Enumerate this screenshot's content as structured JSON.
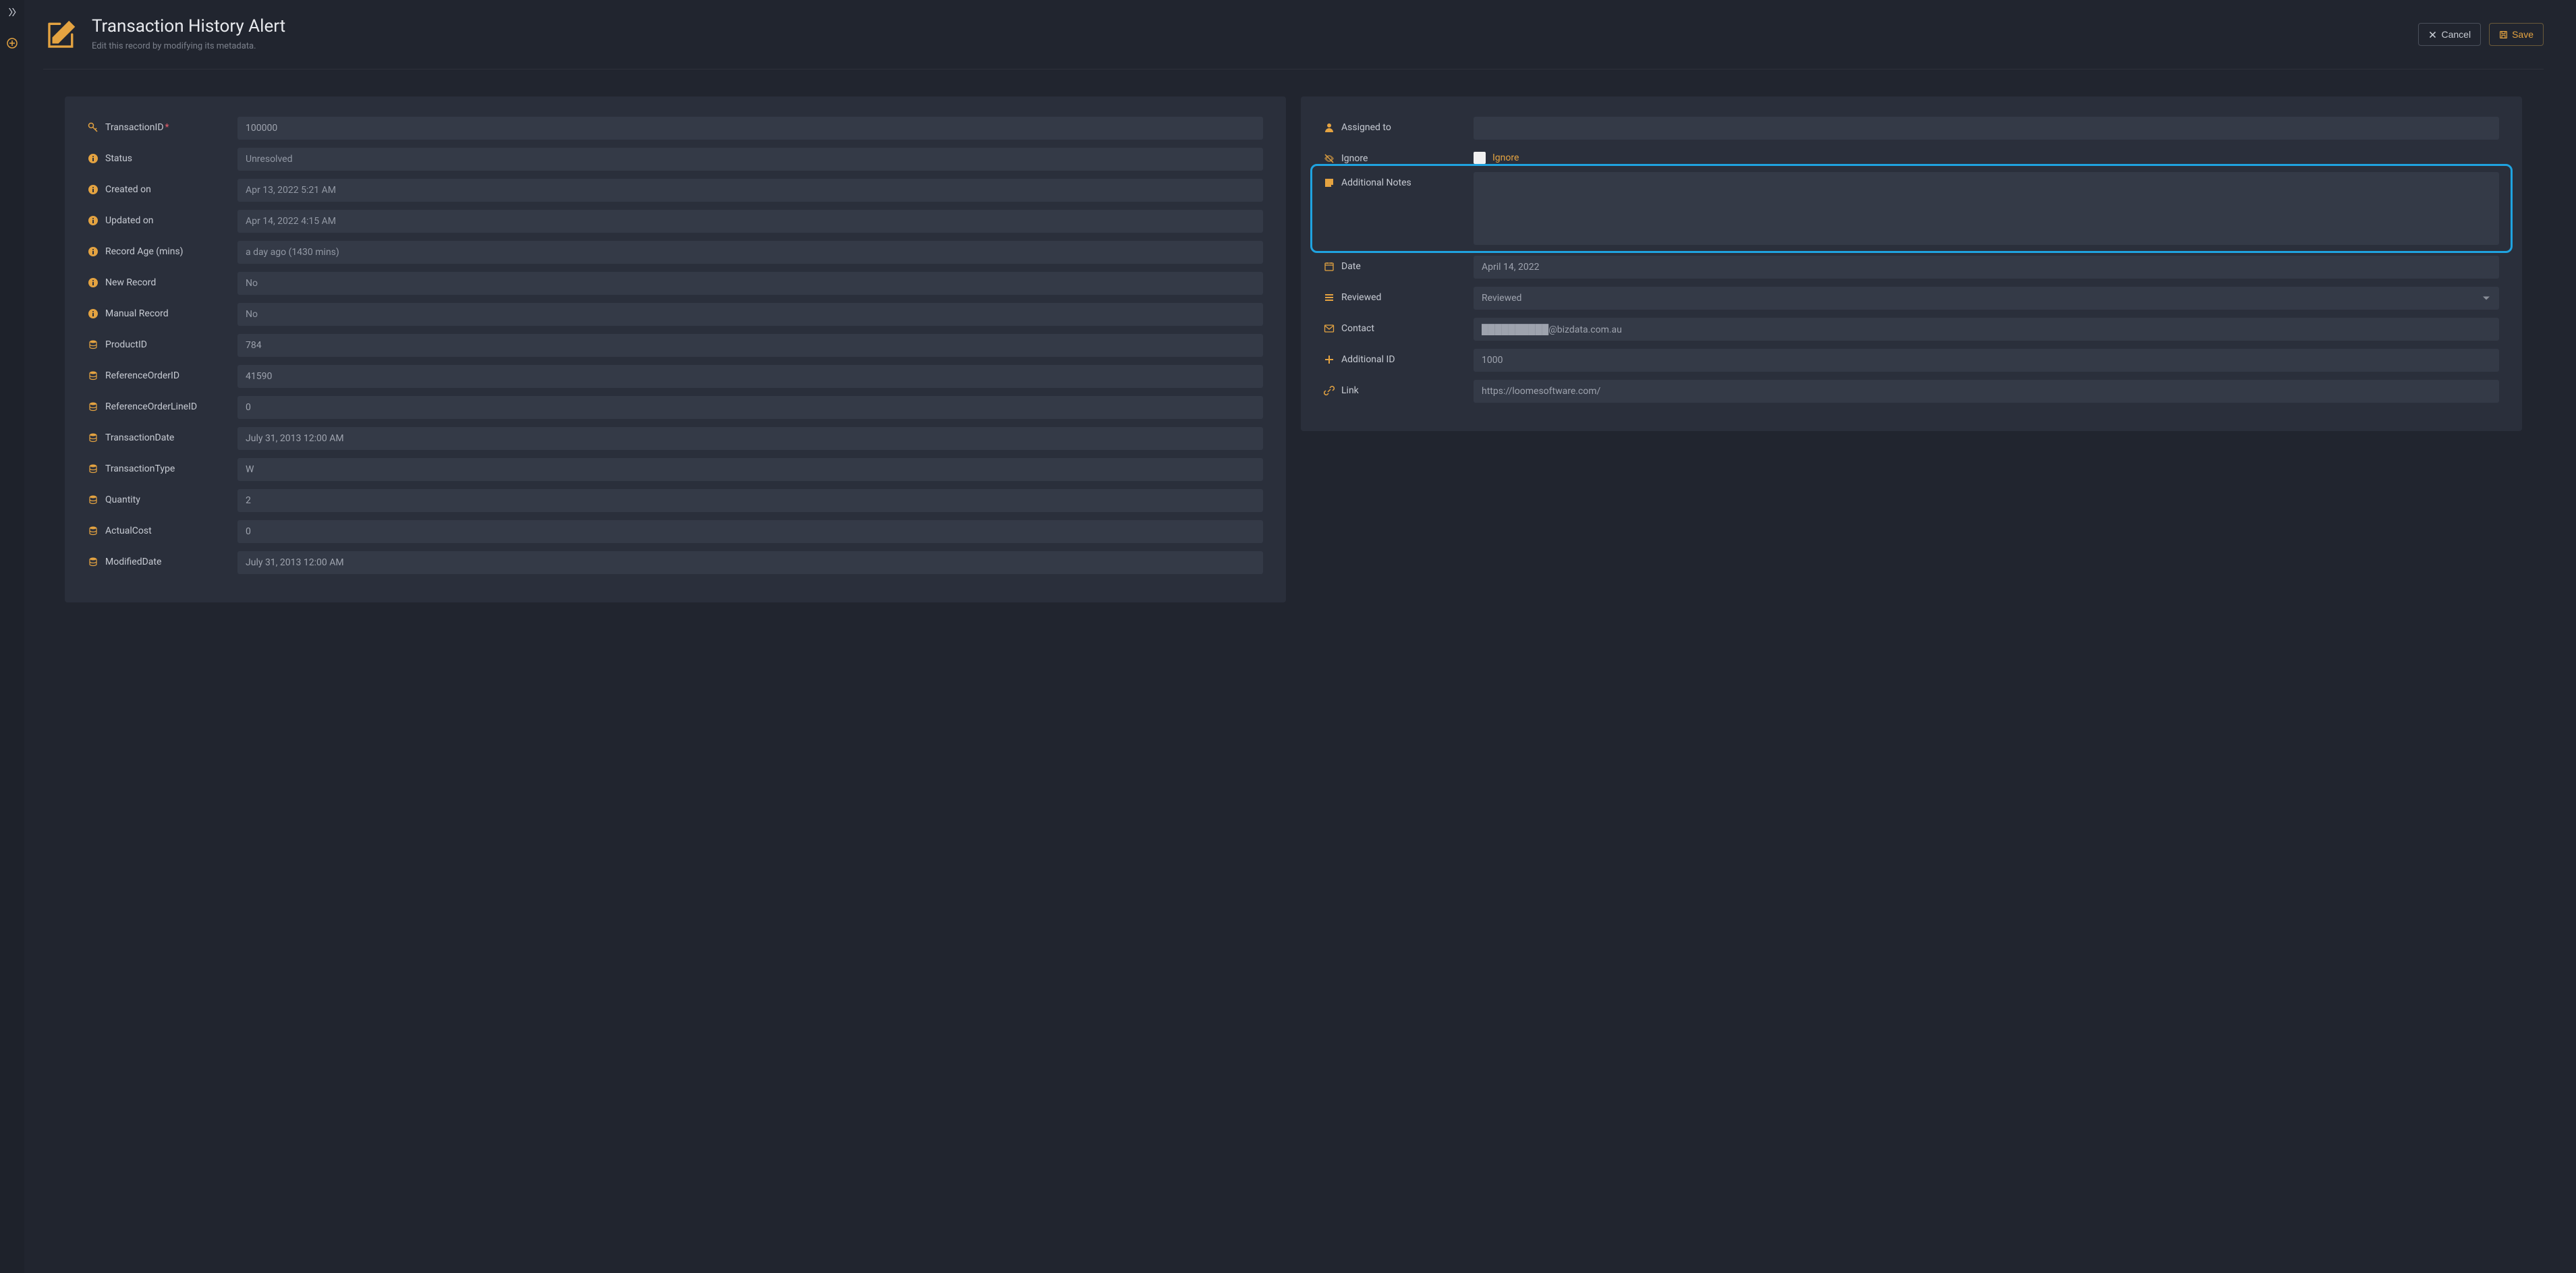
{
  "header": {
    "title": "Transaction History Alert",
    "subtitle": "Edit this record by modifying its metadata.",
    "cancel": "Cancel",
    "save": "Save"
  },
  "left": {
    "transactionId": {
      "label": "TransactionID",
      "value": "100000"
    },
    "status": {
      "label": "Status",
      "value": "Unresolved"
    },
    "createdOn": {
      "label": "Created on",
      "value": "Apr 13, 2022 5:21 AM"
    },
    "updatedOn": {
      "label": "Updated on",
      "value": "Apr 14, 2022 4:15 AM"
    },
    "recordAge": {
      "label": "Record Age (mins)",
      "value": "a day ago (1430 mins)"
    },
    "newRecord": {
      "label": "New Record",
      "value": "No"
    },
    "manualRecord": {
      "label": "Manual Record",
      "value": "No"
    },
    "productId": {
      "label": "ProductID",
      "value": "784"
    },
    "refOrderId": {
      "label": "ReferenceOrderID",
      "value": "41590"
    },
    "refOrderLineId": {
      "label": "ReferenceOrderLineID",
      "value": "0"
    },
    "transactionDate": {
      "label": "TransactionDate",
      "value": "July 31, 2013 12:00 AM"
    },
    "transactionType": {
      "label": "TransactionType",
      "value": "W"
    },
    "quantity": {
      "label": "Quantity",
      "value": "2"
    },
    "actualCost": {
      "label": "ActualCost",
      "value": "0"
    },
    "modifiedDate": {
      "label": "ModifiedDate",
      "value": "July 31, 2013 12:00 AM"
    }
  },
  "right": {
    "assignedTo": {
      "label": "Assigned to",
      "value": ""
    },
    "ignore": {
      "label": "Ignore",
      "chkLabel": "Ignore"
    },
    "additionalNotes": {
      "label": "Additional Notes",
      "value": ""
    },
    "date": {
      "label": "Date",
      "value": "April 14, 2022"
    },
    "reviewed": {
      "label": "Reviewed",
      "value": "Reviewed"
    },
    "contact": {
      "label": "Contact",
      "value": "██████████@bizdata.com.au"
    },
    "additionalId": {
      "label": "Additional ID",
      "value": "1000"
    },
    "link": {
      "label": "Link",
      "value": "https://loomesoftware.com/"
    }
  }
}
